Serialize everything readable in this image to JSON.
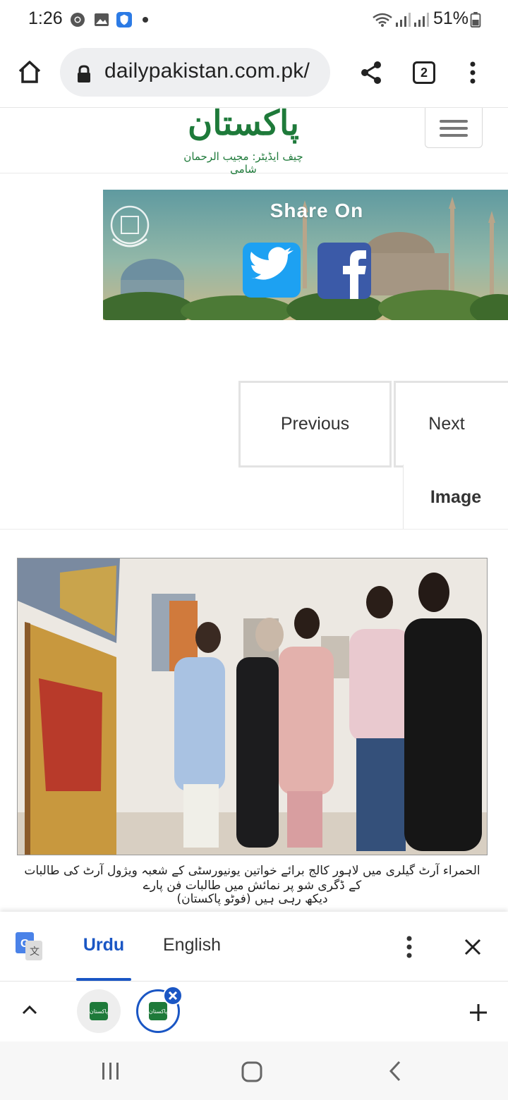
{
  "status_bar": {
    "time": "1:26",
    "battery_percent": "51%",
    "icons": [
      "chrome-icon",
      "gallery-icon",
      "shield-app-icon",
      "dot-icon",
      "wifi-icon",
      "signal-icon",
      "signal-icon-2",
      "battery-icon"
    ]
  },
  "browser": {
    "url": "dailypakistan.com.pk/",
    "tab_count": "2",
    "icons": [
      "home-icon",
      "lock-icon",
      "share-icon",
      "tabs-icon",
      "more-vert-icon"
    ]
  },
  "site": {
    "logo_text": "پاکستان",
    "editor_line": "چیف ایڈیٹر: مجیب الرحمان شامی",
    "brand_color": "#1e7a3a"
  },
  "banner": {
    "title": "Share On",
    "icons": [
      "twitter-icon",
      "facebook-icon",
      "emblem-icon"
    ]
  },
  "pager": {
    "previous_label": "Previous",
    "next_label": "Next",
    "image_tab_label": "Image"
  },
  "article": {
    "caption_line1": "الحمراء آرٹ گیلری میں لاہور کالج برائے خواتین یونیورسٹی کے شعبہ ویژول آرٹ کی طالبات کے ڈگری شو پر نمائش میں طالبات فن پارے",
    "caption_line2": "دیکھ رہی ہیں (فوٹو پاکستان)"
  },
  "translate_bar": {
    "source_language": "Urdu",
    "target_language": "English",
    "accent_color": "#1a56c4"
  },
  "tab_strip": {
    "tabs": [
      {
        "favicon_text": "پاکستان",
        "active": false
      },
      {
        "favicon_text": "پاکستان",
        "active": true
      }
    ]
  }
}
